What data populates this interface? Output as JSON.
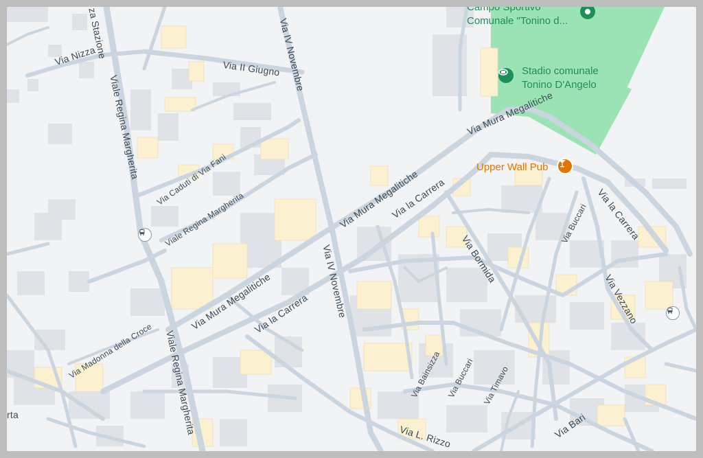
{
  "map": {
    "colors": {
      "background": "#f1f3f4",
      "road": "#cbd5df",
      "road_outline": "#b9c5d1",
      "building": "#dfe2e7",
      "building_highlight": "#fbf0d0",
      "park": "#9be3b4",
      "label": "#3c4a56",
      "poi_green": "#1e8e5b",
      "poi_orange": "#e37400"
    },
    "streets": [
      "Via Nizza",
      "za Stazione",
      "Viale Regina Margherita",
      "Via IV Novembre",
      "Via II Giugno",
      "Via Caduti di Via Fani",
      "Viale Regina Margherita",
      "Via Mura Megalitiche",
      "Via Mura Megalitiche",
      "Via Mura Megalitiche",
      "Via la Carrera",
      "Via la Carrera",
      "Via la Carrera",
      "Via IV Novembre",
      "Via Madonna della Croce",
      "Viale Regina Margherita",
      "Via Bormida",
      "Via Buccari",
      "Via Vezzano",
      "Via Bainsizza",
      "Via Buccari",
      "Via Timavo",
      "Via Bari",
      "Via L. Rizzo",
      "rta"
    ],
    "places": {
      "campo": "Campo Sportivo\nComunale \"Tonino d...",
      "stadio": "Stadio comunale\nTonino D'Angelo",
      "pub": "Upper Wall Pub"
    },
    "icons": [
      "location-pin-icon",
      "stadium-icon",
      "cocktail-bar-icon",
      "bus-stop-icon"
    ]
  }
}
